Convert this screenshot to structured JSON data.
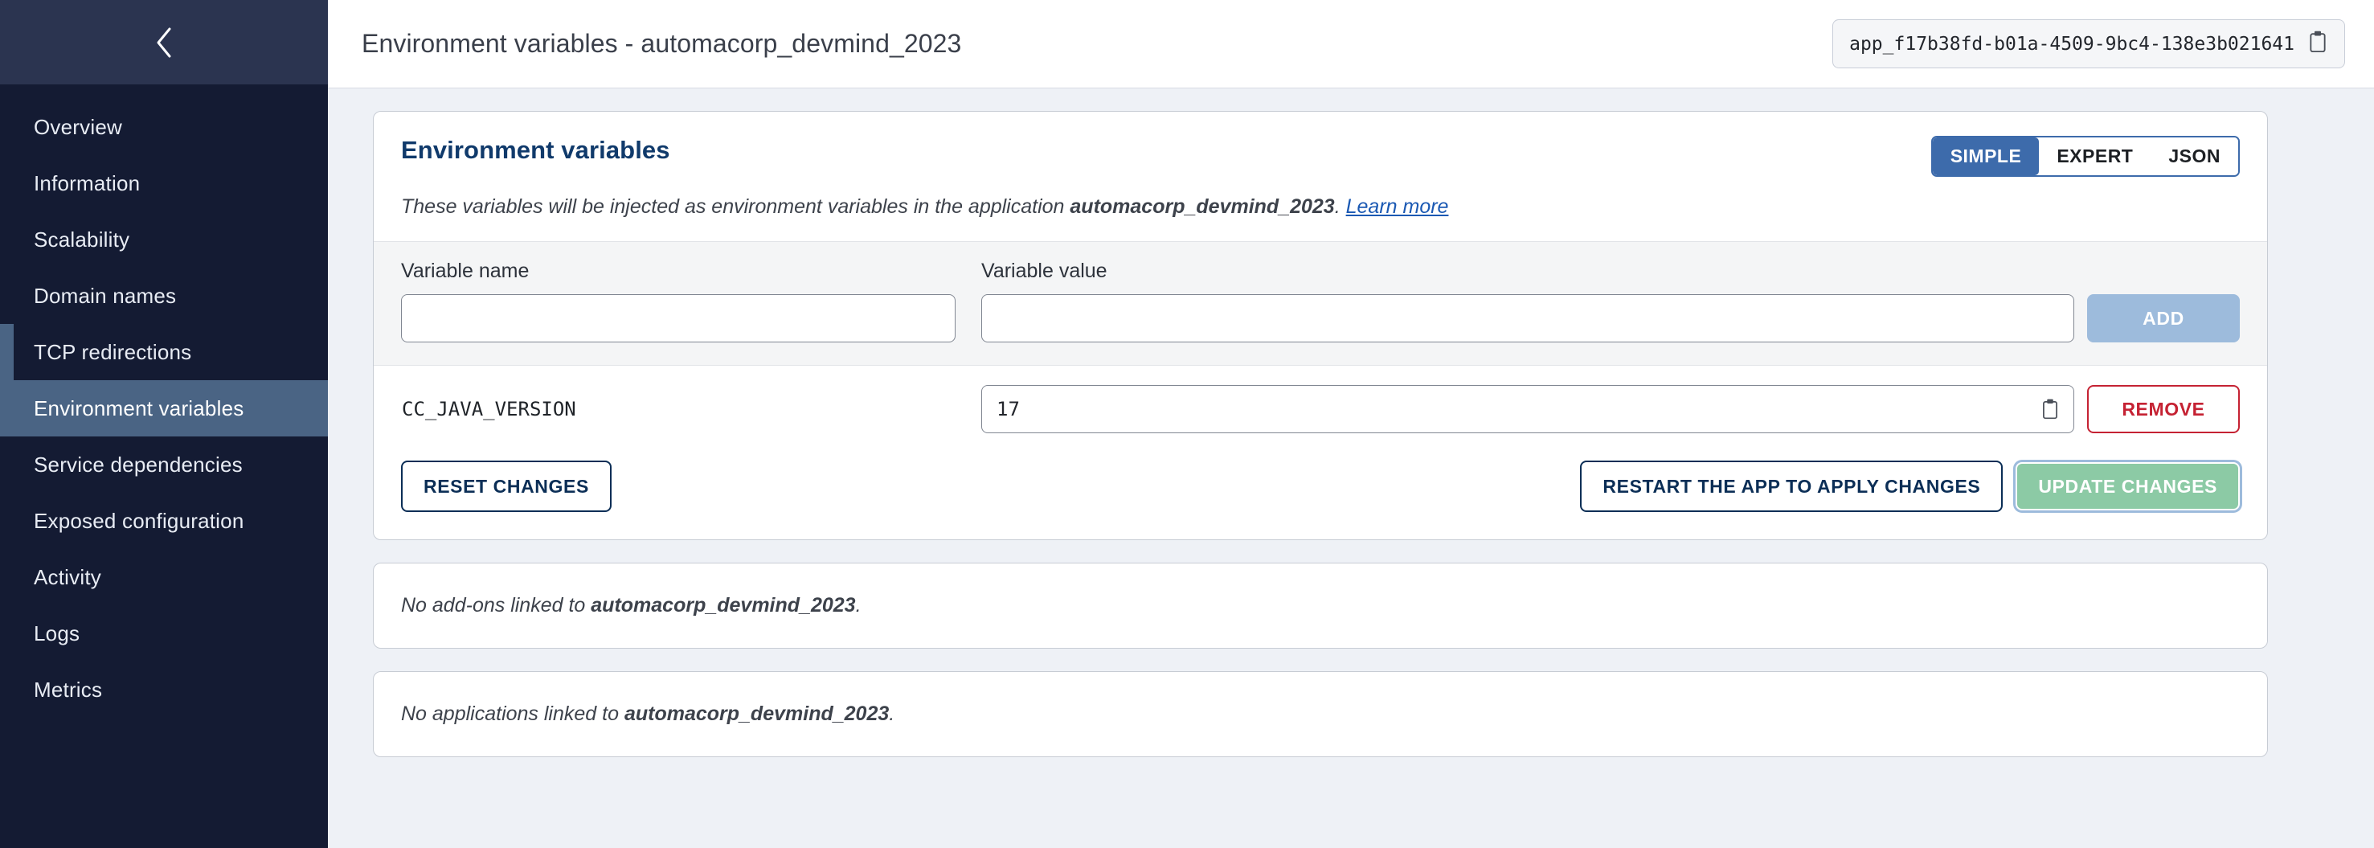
{
  "sidebar": {
    "collapse_icon": "chevron-left-icon",
    "items": [
      {
        "label": "Overview",
        "active": false,
        "edge_marker": false
      },
      {
        "label": "Information",
        "active": false,
        "edge_marker": false
      },
      {
        "label": "Scalability",
        "active": false,
        "edge_marker": false
      },
      {
        "label": "Domain names",
        "active": false,
        "edge_marker": false
      },
      {
        "label": "TCP redirections",
        "active": false,
        "edge_marker": true
      },
      {
        "label": "Environment variables",
        "active": true,
        "edge_marker": false
      },
      {
        "label": "Service dependencies",
        "active": false,
        "edge_marker": false
      },
      {
        "label": "Exposed configuration",
        "active": false,
        "edge_marker": false
      },
      {
        "label": "Activity",
        "active": false,
        "edge_marker": false
      },
      {
        "label": "Logs",
        "active": false,
        "edge_marker": false
      },
      {
        "label": "Metrics",
        "active": false,
        "edge_marker": false
      }
    ]
  },
  "topbar": {
    "title": "Environment variables - automacorp_devmind_2023",
    "app_id": "app_f17b38fd-b01a-4509-9bc4-138e3b021641",
    "copy_icon": "clipboard-icon"
  },
  "env_card": {
    "title": "Environment variables",
    "modes": [
      {
        "label": "SIMPLE",
        "active": true
      },
      {
        "label": "EXPERT",
        "active": false
      },
      {
        "label": "JSON",
        "active": false
      }
    ],
    "description_prefix": "These variables will be injected as environment variables in the application ",
    "description_app": "automacorp_devmind_2023",
    "description_suffix": ". ",
    "learn_more": "Learn more",
    "form": {
      "name_label": "Variable name",
      "value_label": "Variable value",
      "name_value": "",
      "value_value": "",
      "name_placeholder": "",
      "value_placeholder": "",
      "add_label": "ADD"
    },
    "variables": [
      {
        "name": "CC_JAVA_VERSION",
        "value": "17",
        "copy_icon": "clipboard-icon",
        "remove_label": "REMOVE"
      }
    ],
    "actions": {
      "reset_label": "RESET CHANGES",
      "restart_label": "RESTART THE APP TO APPLY CHANGES",
      "update_label": "UPDATE CHANGES"
    }
  },
  "addons_card": {
    "prefix": "No add-ons linked to ",
    "app": "automacorp_devmind_2023",
    "suffix": "."
  },
  "apps_card": {
    "prefix": "No applications linked to ",
    "app": "automacorp_devmind_2023",
    "suffix": "."
  },
  "colors": {
    "sidebar_bg": "#141b33",
    "sidebar_header_bg": "#2b3450",
    "sidebar_active": "#4a6484",
    "accent_blue": "#3d6bab",
    "title_navy": "#103a6b",
    "danger_red": "#c52233",
    "success_green": "#8ccaa5",
    "page_bg": "#eef1f6"
  }
}
